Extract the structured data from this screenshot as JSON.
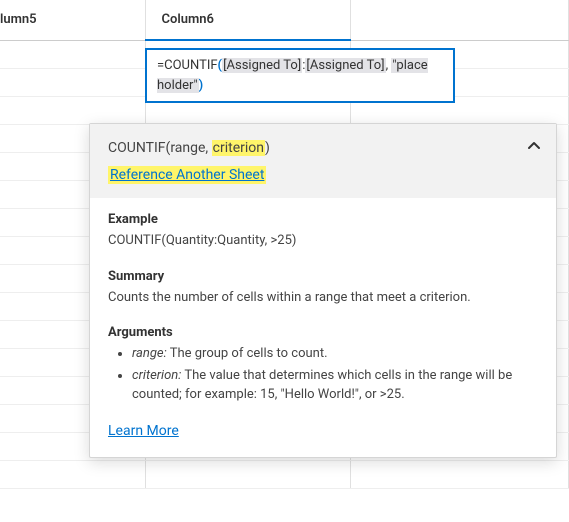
{
  "columns": {
    "col5": "lumn5",
    "col6": "Column6"
  },
  "formula": {
    "eq": "=",
    "func": "COUNTIF",
    "open": "(",
    "ref1": "[Assigned To]",
    "colon": ":",
    "ref2": "[Assigned To]",
    "comma": ", ",
    "str": "\"place holder\"",
    "close": ")"
  },
  "help": {
    "sig_func": "COUNTIF",
    "sig_open": "(",
    "sig_range": "range",
    "sig_sep": ", ",
    "sig_crit": "criterion",
    "sig_close": ")",
    "ref_link": "Reference Another Sheet",
    "collapse_icon": "⌃",
    "example_label": "Example",
    "example_text": "COUNTIF(Quantity:Quantity, >25)",
    "summary_label": "Summary",
    "summary_text": "Counts the number of cells within a range that meet a criterion.",
    "arguments_label": "Arguments",
    "arg1_name": "range:",
    "arg1_desc": " The group of cells to count.",
    "arg2_name": "criterion:",
    "arg2_desc": " The value that determines which cells in the range will be counted; for example: 15, \"Hello World!\", or >25.",
    "learn_more": "Learn More"
  }
}
